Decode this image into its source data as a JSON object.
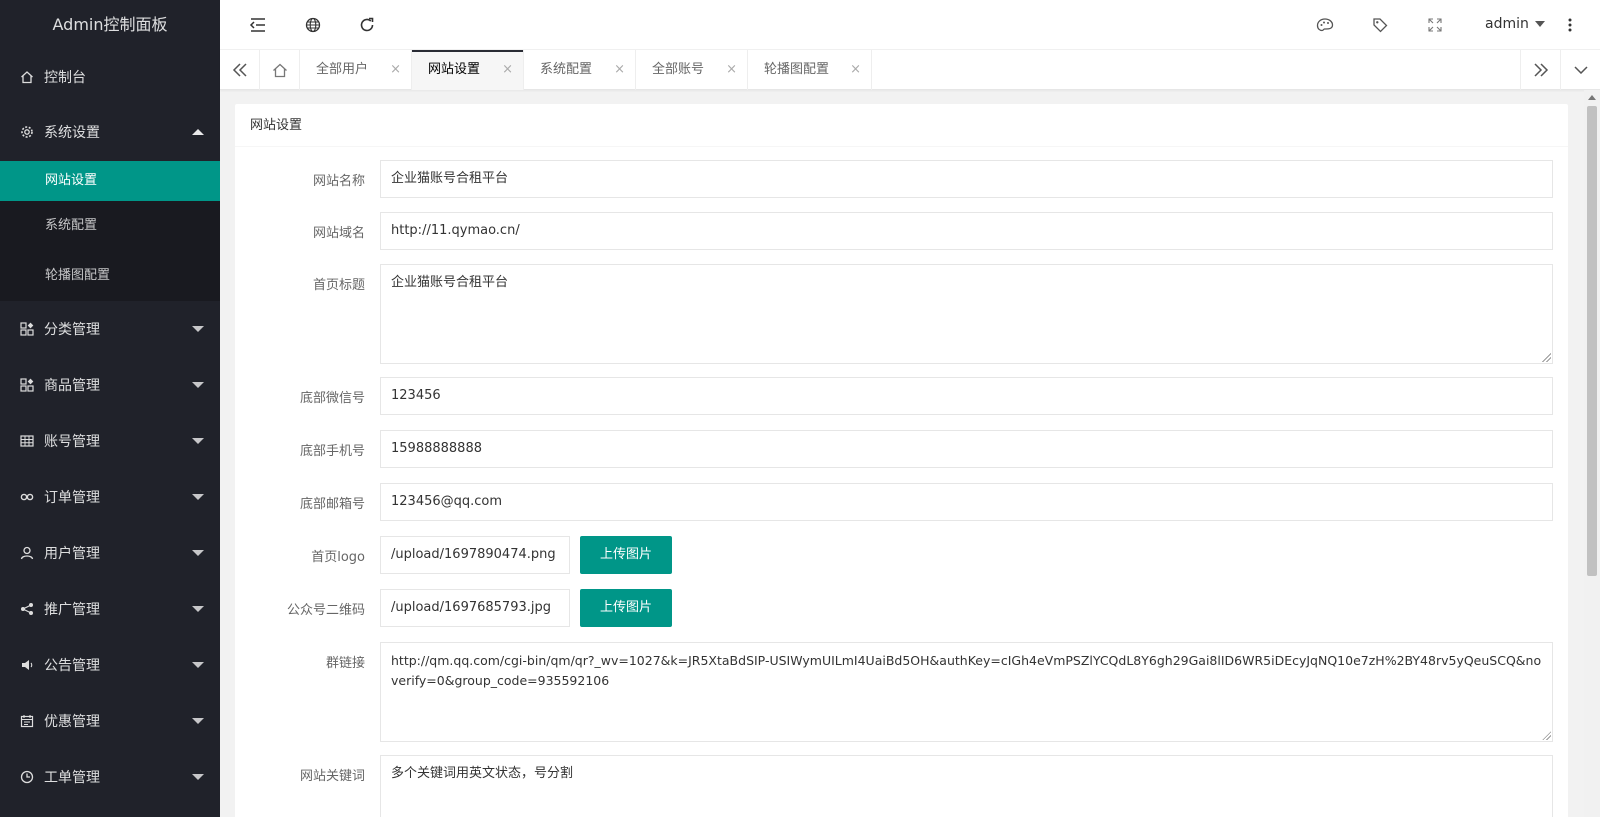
{
  "app": {
    "title": "Admin控制面板"
  },
  "sidebar": {
    "items": [
      {
        "label": "控制台",
        "icon": "home-icon"
      },
      {
        "label": "系统设置",
        "icon": "gear-icon",
        "expanded": true,
        "children": [
          {
            "label": "网站设置",
            "active": true
          },
          {
            "label": "系统配置"
          },
          {
            "label": "轮播图配置"
          }
        ]
      },
      {
        "label": "分类管理",
        "icon": "apps-icon"
      },
      {
        "label": "商品管理",
        "icon": "apps-icon"
      },
      {
        "label": "账号管理",
        "icon": "table-icon"
      },
      {
        "label": "订单管理",
        "icon": "link-icon"
      },
      {
        "label": "用户管理",
        "icon": "user-icon"
      },
      {
        "label": "推广管理",
        "icon": "share-icon"
      },
      {
        "label": "公告管理",
        "icon": "speaker-icon"
      },
      {
        "label": "优惠管理",
        "icon": "calendar-icon"
      },
      {
        "label": "工单管理",
        "icon": "clock-icon"
      }
    ]
  },
  "header": {
    "icons": [
      "menu-fold-icon",
      "globe-icon",
      "refresh-icon",
      "theme-icon",
      "tag-icon",
      "fullscreen-icon",
      "more-icon"
    ],
    "user": "admin"
  },
  "tabs": [
    {
      "label": "全部用户"
    },
    {
      "label": "网站设置",
      "active": true
    },
    {
      "label": "系统配置"
    },
    {
      "label": "全部账号"
    },
    {
      "label": "轮播图配置"
    }
  ],
  "tab_close_glyph": "×",
  "card": {
    "title": "网站设置",
    "fields": {
      "site_name": {
        "label": "网站名称",
        "value": "企业猫账号合租平台"
      },
      "site_domain": {
        "label": "网站域名",
        "value": "http://11.qymao.cn/"
      },
      "home_title": {
        "label": "首页标题",
        "value": "企业猫账号合租平台"
      },
      "wechat": {
        "label": "底部微信号",
        "value": "123456"
      },
      "phone": {
        "label": "底部手机号",
        "value": "15988888888"
      },
      "email": {
        "label": "底部邮箱号",
        "value": "123456@qq.com"
      },
      "logo": {
        "label": "首页logo",
        "value": "/upload/1697890474.png",
        "button": "上传图片"
      },
      "qrcode": {
        "label": "公众号二维码",
        "value": "/upload/1697685793.jpg",
        "button": "上传图片"
      },
      "group_link": {
        "label": "群链接",
        "value": "http://qm.qq.com/cgi-bin/qm/qr?_wv=1027&k=JR5XtaBdSIP-USIWymUILmI4UaiBd5OH&authKey=cIGh4eVmPSZlYCQdL8Y6gh29Gai8lID6WR5iDEcyJqNQ10e7zH%2BY48rv5yQeuSCQ&noverify=0&group_code=935592106"
      },
      "keywords": {
        "label": "网站关键词",
        "value": "多个关键词用英文状态，号分割"
      }
    }
  },
  "colors": {
    "accent": "#009688",
    "sidebar_bg": "#20222a",
    "submenu_bg": "#191a20"
  }
}
